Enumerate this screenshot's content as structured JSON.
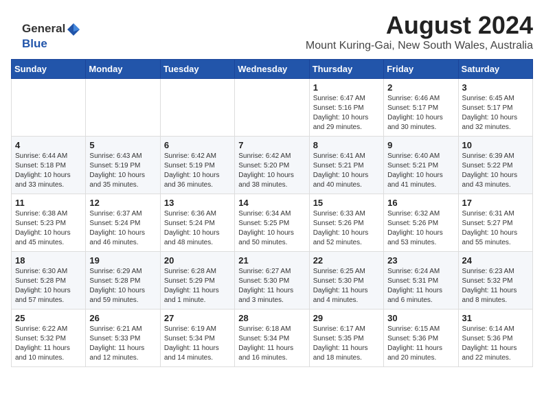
{
  "logo": {
    "general": "General",
    "blue": "Blue"
  },
  "header": {
    "month_year": "August 2024",
    "location": "Mount Kuring-Gai, New South Wales, Australia"
  },
  "weekdays": [
    "Sunday",
    "Monday",
    "Tuesday",
    "Wednesday",
    "Thursday",
    "Friday",
    "Saturday"
  ],
  "weeks": [
    [
      {
        "day": "",
        "info": ""
      },
      {
        "day": "",
        "info": ""
      },
      {
        "day": "",
        "info": ""
      },
      {
        "day": "",
        "info": ""
      },
      {
        "day": "1",
        "info": "Sunrise: 6:47 AM\nSunset: 5:16 PM\nDaylight: 10 hours\nand 29 minutes."
      },
      {
        "day": "2",
        "info": "Sunrise: 6:46 AM\nSunset: 5:17 PM\nDaylight: 10 hours\nand 30 minutes."
      },
      {
        "day": "3",
        "info": "Sunrise: 6:45 AM\nSunset: 5:17 PM\nDaylight: 10 hours\nand 32 minutes."
      }
    ],
    [
      {
        "day": "4",
        "info": "Sunrise: 6:44 AM\nSunset: 5:18 PM\nDaylight: 10 hours\nand 33 minutes."
      },
      {
        "day": "5",
        "info": "Sunrise: 6:43 AM\nSunset: 5:19 PM\nDaylight: 10 hours\nand 35 minutes."
      },
      {
        "day": "6",
        "info": "Sunrise: 6:42 AM\nSunset: 5:19 PM\nDaylight: 10 hours\nand 36 minutes."
      },
      {
        "day": "7",
        "info": "Sunrise: 6:42 AM\nSunset: 5:20 PM\nDaylight: 10 hours\nand 38 minutes."
      },
      {
        "day": "8",
        "info": "Sunrise: 6:41 AM\nSunset: 5:21 PM\nDaylight: 10 hours\nand 40 minutes."
      },
      {
        "day": "9",
        "info": "Sunrise: 6:40 AM\nSunset: 5:21 PM\nDaylight: 10 hours\nand 41 minutes."
      },
      {
        "day": "10",
        "info": "Sunrise: 6:39 AM\nSunset: 5:22 PM\nDaylight: 10 hours\nand 43 minutes."
      }
    ],
    [
      {
        "day": "11",
        "info": "Sunrise: 6:38 AM\nSunset: 5:23 PM\nDaylight: 10 hours\nand 45 minutes."
      },
      {
        "day": "12",
        "info": "Sunrise: 6:37 AM\nSunset: 5:24 PM\nDaylight: 10 hours\nand 46 minutes."
      },
      {
        "day": "13",
        "info": "Sunrise: 6:36 AM\nSunset: 5:24 PM\nDaylight: 10 hours\nand 48 minutes."
      },
      {
        "day": "14",
        "info": "Sunrise: 6:34 AM\nSunset: 5:25 PM\nDaylight: 10 hours\nand 50 minutes."
      },
      {
        "day": "15",
        "info": "Sunrise: 6:33 AM\nSunset: 5:26 PM\nDaylight: 10 hours\nand 52 minutes."
      },
      {
        "day": "16",
        "info": "Sunrise: 6:32 AM\nSunset: 5:26 PM\nDaylight: 10 hours\nand 53 minutes."
      },
      {
        "day": "17",
        "info": "Sunrise: 6:31 AM\nSunset: 5:27 PM\nDaylight: 10 hours\nand 55 minutes."
      }
    ],
    [
      {
        "day": "18",
        "info": "Sunrise: 6:30 AM\nSunset: 5:28 PM\nDaylight: 10 hours\nand 57 minutes."
      },
      {
        "day": "19",
        "info": "Sunrise: 6:29 AM\nSunset: 5:28 PM\nDaylight: 10 hours\nand 59 minutes."
      },
      {
        "day": "20",
        "info": "Sunrise: 6:28 AM\nSunset: 5:29 PM\nDaylight: 11 hours\nand 1 minute."
      },
      {
        "day": "21",
        "info": "Sunrise: 6:27 AM\nSunset: 5:30 PM\nDaylight: 11 hours\nand 3 minutes."
      },
      {
        "day": "22",
        "info": "Sunrise: 6:25 AM\nSunset: 5:30 PM\nDaylight: 11 hours\nand 4 minutes."
      },
      {
        "day": "23",
        "info": "Sunrise: 6:24 AM\nSunset: 5:31 PM\nDaylight: 11 hours\nand 6 minutes."
      },
      {
        "day": "24",
        "info": "Sunrise: 6:23 AM\nSunset: 5:32 PM\nDaylight: 11 hours\nand 8 minutes."
      }
    ],
    [
      {
        "day": "25",
        "info": "Sunrise: 6:22 AM\nSunset: 5:32 PM\nDaylight: 11 hours\nand 10 minutes."
      },
      {
        "day": "26",
        "info": "Sunrise: 6:21 AM\nSunset: 5:33 PM\nDaylight: 11 hours\nand 12 minutes."
      },
      {
        "day": "27",
        "info": "Sunrise: 6:19 AM\nSunset: 5:34 PM\nDaylight: 11 hours\nand 14 minutes."
      },
      {
        "day": "28",
        "info": "Sunrise: 6:18 AM\nSunset: 5:34 PM\nDaylight: 11 hours\nand 16 minutes."
      },
      {
        "day": "29",
        "info": "Sunrise: 6:17 AM\nSunset: 5:35 PM\nDaylight: 11 hours\nand 18 minutes."
      },
      {
        "day": "30",
        "info": "Sunrise: 6:15 AM\nSunset: 5:36 PM\nDaylight: 11 hours\nand 20 minutes."
      },
      {
        "day": "31",
        "info": "Sunrise: 6:14 AM\nSunset: 5:36 PM\nDaylight: 11 hours\nand 22 minutes."
      }
    ]
  ]
}
